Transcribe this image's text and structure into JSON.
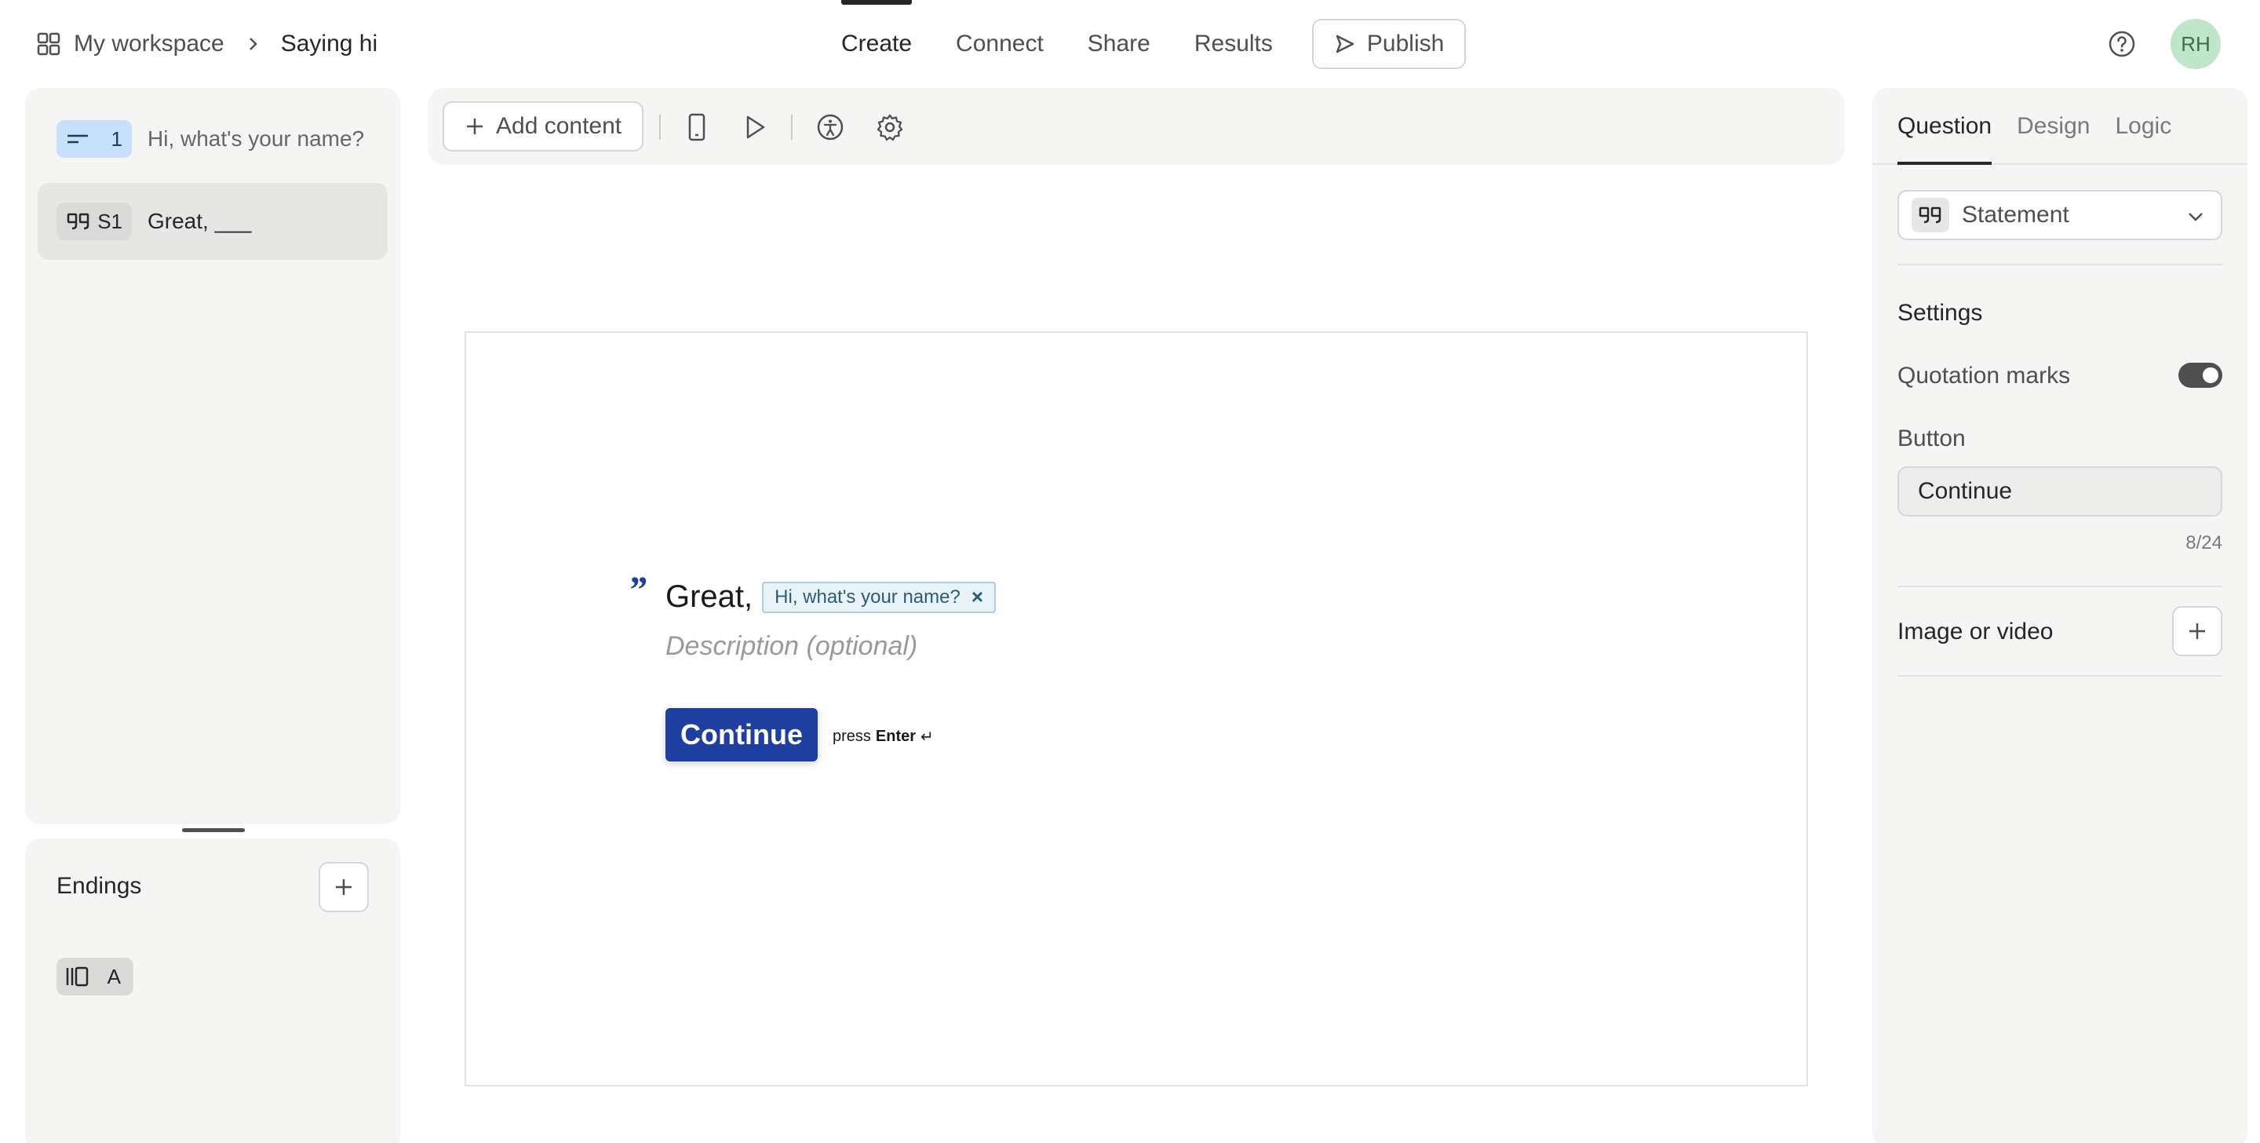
{
  "breadcrumb": {
    "workspace": "My workspace",
    "form": "Saying hi"
  },
  "nav": {
    "tabs": [
      "Create",
      "Connect",
      "Share",
      "Results"
    ],
    "active": "Create",
    "publish_label": "Publish"
  },
  "user": {
    "initials": "RH",
    "avatar_color": "#bfe6c9"
  },
  "questions": [
    {
      "badge": "1",
      "label": "Hi, what's your name?",
      "badge_color": "#c6e0fb",
      "icon": "short-text-icon"
    },
    {
      "badge": "S1",
      "label": "Great, ___",
      "badge_color": "#dadad9",
      "icon": "quote-icon",
      "selected": true
    }
  ],
  "endings": {
    "title": "Endings",
    "items": [
      {
        "badge": "A",
        "icon": "ending-icon"
      }
    ]
  },
  "toolbar": {
    "add_content_label": "Add content",
    "icons": [
      "mobile-preview-icon",
      "play-icon",
      "accessibility-icon",
      "settings-gear-icon"
    ]
  },
  "canvas": {
    "quote_mark": "”",
    "statement_text": "Great,",
    "recall_chip": "Hi, what's your name?",
    "recall_remove": "×",
    "description_placeholder": "Description (optional)",
    "button_label": "Continue",
    "hint_press": "press",
    "hint_key": "Enter",
    "hint_symbol": "↵",
    "button_color": "#1f3fa0"
  },
  "panel": {
    "tabs": [
      "Question",
      "Design",
      "Logic"
    ],
    "active_tab": "Question",
    "type_label": "Statement",
    "settings_heading": "Settings",
    "quotation_marks_label": "Quotation marks",
    "quotation_marks_on": true,
    "button_heading": "Button",
    "button_value": "Continue",
    "button_counter": "8/24",
    "media_label": "Image or video"
  }
}
